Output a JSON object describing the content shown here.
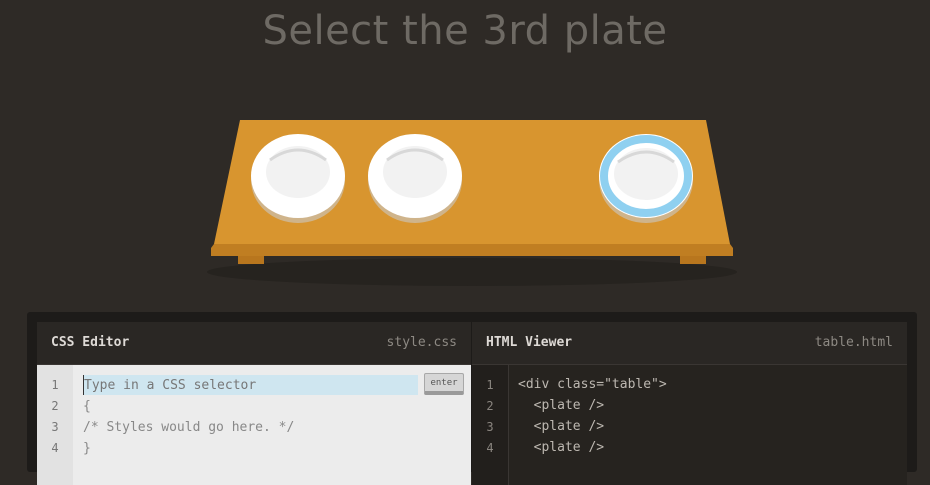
{
  "title": "Select the 3rd plate",
  "table": {
    "plates": [
      {
        "name": "plate-1",
        "selected": false
      },
      {
        "name": "plate-2",
        "selected": false
      },
      {
        "name": "plate-3",
        "selected": true
      }
    ],
    "colors": {
      "table": "#d4912f",
      "plate": "#ffffff",
      "highlight": "#8fd0f0"
    }
  },
  "css_editor": {
    "title": "CSS Editor",
    "filename": "style.css",
    "placeholder": "Type in a CSS selector",
    "enter_label": "enter",
    "line_numbers": [
      "1",
      "2",
      "3",
      "4"
    ],
    "lines": [
      "{",
      "/* Styles would go here. */",
      "}"
    ]
  },
  "html_viewer": {
    "title": "HTML Viewer",
    "filename": "table.html",
    "line_numbers": [
      "1",
      "2",
      "3",
      "4"
    ],
    "lines": [
      "<div class=\"table\">",
      "  <plate />",
      "  <plate />",
      "  <plate />"
    ]
  }
}
